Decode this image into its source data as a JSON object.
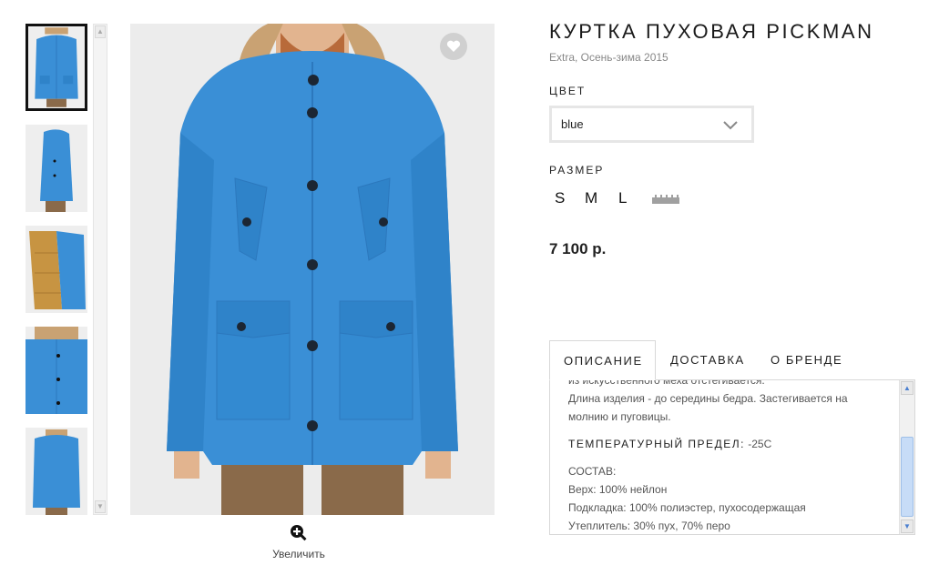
{
  "product": {
    "title": "КУРТКА ПУХОВАЯ PICKMAN",
    "subtitle": "Extra, Осень-зима 2015",
    "color_label": "ЦВЕТ",
    "color_value": "blue",
    "size_label": "РАЗМЕР",
    "sizes": [
      "S",
      "M",
      "L"
    ],
    "size_chart_icon": "ruler-icon",
    "price": "7 100 р."
  },
  "gallery": {
    "thumbnails": [
      {
        "alt": "front"
      },
      {
        "alt": "side"
      },
      {
        "alt": "lining"
      },
      {
        "alt": "detail"
      },
      {
        "alt": "back"
      }
    ],
    "zoom_label": "Увеличить",
    "favorite_icon": "heart-icon",
    "zoom_icon": "zoom-in-icon"
  },
  "tabs": [
    "ОПИСАНИЕ",
    "ДОСТАВКА",
    "О БРЕНДЕ"
  ],
  "description": {
    "line1": "из искусственного меха отстегивается.",
    "line2": "Длина изделия - до середины бедра. Застегивается на",
    "line3": "молнию и пуговицы.",
    "temp_label": "ТЕМПЕРАТУРНЫЙ ПРЕДЕЛ:",
    "temp_value": "-25C",
    "composition_label": "СОСТАВ:",
    "comp1": "Верх: 100% нейлон",
    "comp2": "Подкладка: 100% полиэстер, пухосодержащая",
    "comp3": "Утеплитель: 30% пух, 70% перо"
  },
  "colors": {
    "jacket": "#3a8fd6",
    "jacket_dark": "#2c78bd",
    "fur": "#c9a273",
    "lining": "#c79442",
    "trousers": "#8a6a4a",
    "scroll_thumb": "#c7dcf7"
  }
}
